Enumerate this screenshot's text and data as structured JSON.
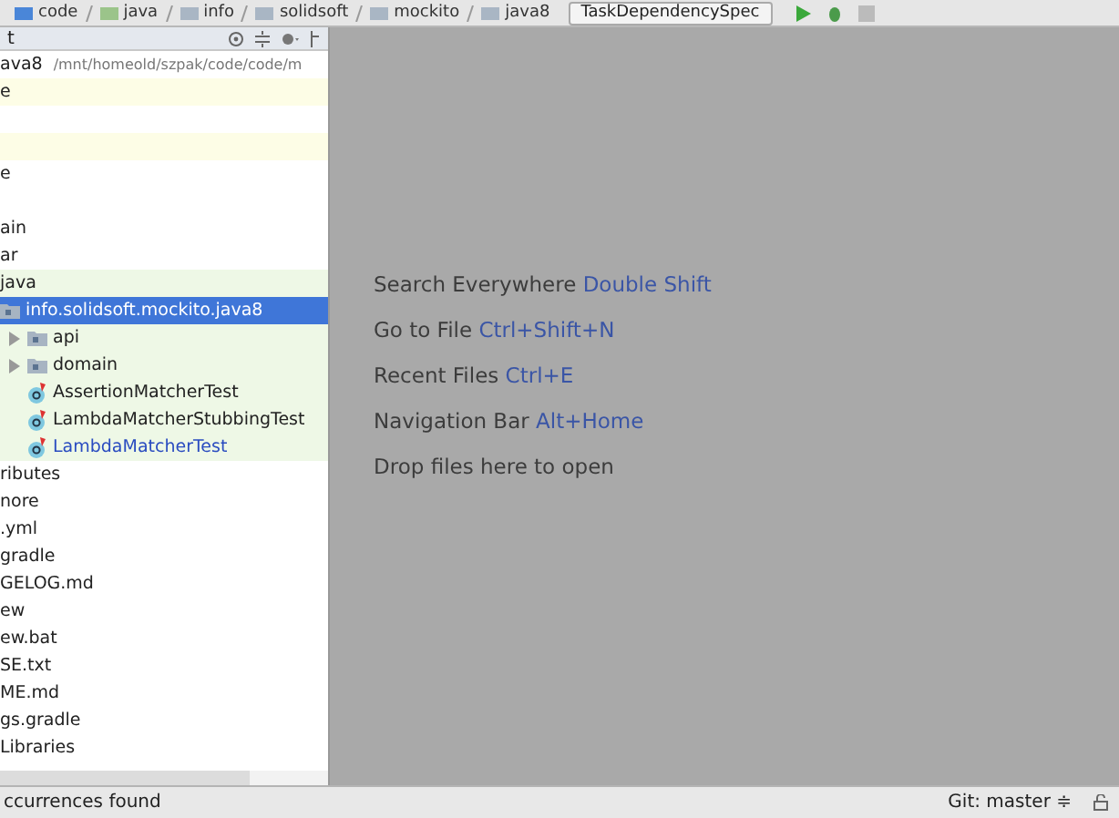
{
  "breadcrumbs": [
    {
      "label": "code",
      "kind": "module"
    },
    {
      "label": "java",
      "kind": "source"
    },
    {
      "label": "info",
      "kind": "folder"
    },
    {
      "label": "solidsoft",
      "kind": "folder"
    },
    {
      "label": "mockito",
      "kind": "folder"
    },
    {
      "label": "java8",
      "kind": "folder"
    }
  ],
  "run_config": {
    "label": "TaskDependencySpec"
  },
  "project_panel": {
    "title": "t",
    "rows": [
      {
        "label": "ava8",
        "path": "/mnt/homeold/szpak/code/code/m",
        "kind": "plain",
        "selected": false
      },
      {
        "label": "e",
        "kind": "plain",
        "color": "#fdfde6",
        "selected": false
      },
      {
        "kind": "plain"
      },
      {
        "kind": "plain",
        "color": "#fdfde6",
        "selected": false
      },
      {
        "label": "e",
        "kind": "plain",
        "selected": false
      },
      {
        "kind": "plain"
      },
      {
        "label": "ain",
        "kind": "plain",
        "selected": false
      },
      {
        "label": "ar",
        "kind": "plain",
        "selected": false
      },
      {
        "label": "java",
        "kind": "plain",
        "color": "#eef8e6",
        "selected": false
      },
      {
        "label": "info.solidsoft.mockito.java8",
        "kind": "package",
        "selected": true
      },
      {
        "label": "api",
        "kind": "package",
        "color": "#eef8e6",
        "expandable": true,
        "indent": true,
        "selected": false
      },
      {
        "label": "domain",
        "kind": "package",
        "color": "#eef8e6",
        "expandable": true,
        "indent": true,
        "selected": false
      },
      {
        "label": "AssertionMatcherTest",
        "kind": "test",
        "color": "#eef8e6",
        "indent": true,
        "selected": false
      },
      {
        "label": "LambdaMatcherStubbingTest",
        "kind": "test",
        "color": "#eef8e6",
        "indent": true,
        "selected": false
      },
      {
        "label": "LambdaMatcherTest",
        "kind": "test",
        "color": "#eef8e6",
        "indent": true,
        "modified": true,
        "selected": false
      },
      {
        "label": "ributes",
        "kind": "plain",
        "selected": false
      },
      {
        "label": "nore",
        "kind": "plain",
        "selected": false
      },
      {
        "label": ".yml",
        "kind": "plain",
        "selected": false
      },
      {
        "label": "gradle",
        "kind": "plain",
        "selected": false
      },
      {
        "label": "GELOG.md",
        "kind": "plain",
        "selected": false
      },
      {
        "label": "ew",
        "kind": "plain",
        "selected": false
      },
      {
        "label": "ew.bat",
        "kind": "plain",
        "selected": false
      },
      {
        "label": "SE.txt",
        "kind": "plain",
        "selected": false
      },
      {
        "label": "ME.md",
        "kind": "plain",
        "selected": false
      },
      {
        "label": "gs.gradle",
        "kind": "plain",
        "selected": false
      },
      {
        "label": "Libraries",
        "kind": "plain",
        "selected": false
      }
    ]
  },
  "hints": [
    {
      "text": "Search Everywhere",
      "shortcut": "Double Shift"
    },
    {
      "text": "Go to File",
      "shortcut": "Ctrl+Shift+N"
    },
    {
      "text": "Recent Files",
      "shortcut": "Ctrl+E"
    },
    {
      "text": "Navigation Bar",
      "shortcut": "Alt+Home"
    },
    {
      "text": "Drop files here to open"
    }
  ],
  "status_bar": {
    "message": "ccurrences found",
    "vcs": "Git: master ≑"
  }
}
